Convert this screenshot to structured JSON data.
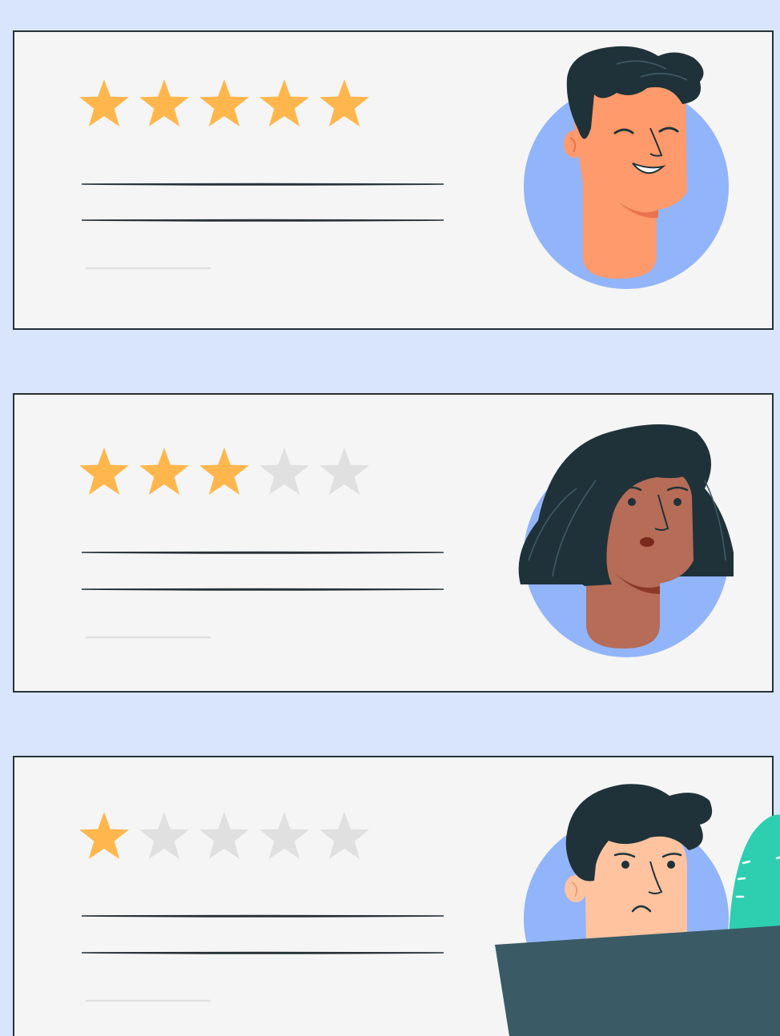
{
  "colors": {
    "background": "#d9e4fd",
    "card": "#f5f5f5",
    "card_border": "#263238",
    "star_filled": "#ffb74d",
    "star_empty": "#e0e0e0",
    "avatar_circle": "#92b4fa",
    "hair": "#1f3239",
    "cactus": "#2dcfb0",
    "desk": "#3a5a66"
  },
  "reviews": [
    {
      "rating": 5,
      "max_rating": 5,
      "text_lines": 3,
      "avatar": "smiling-man-avatar",
      "expression": "happy"
    },
    {
      "rating": 3,
      "max_rating": 5,
      "text_lines": 3,
      "avatar": "woman-avatar",
      "expression": "neutral"
    },
    {
      "rating": 1,
      "max_rating": 5,
      "text_lines": 3,
      "avatar": "frowning-man-avatar",
      "expression": "sad"
    }
  ]
}
